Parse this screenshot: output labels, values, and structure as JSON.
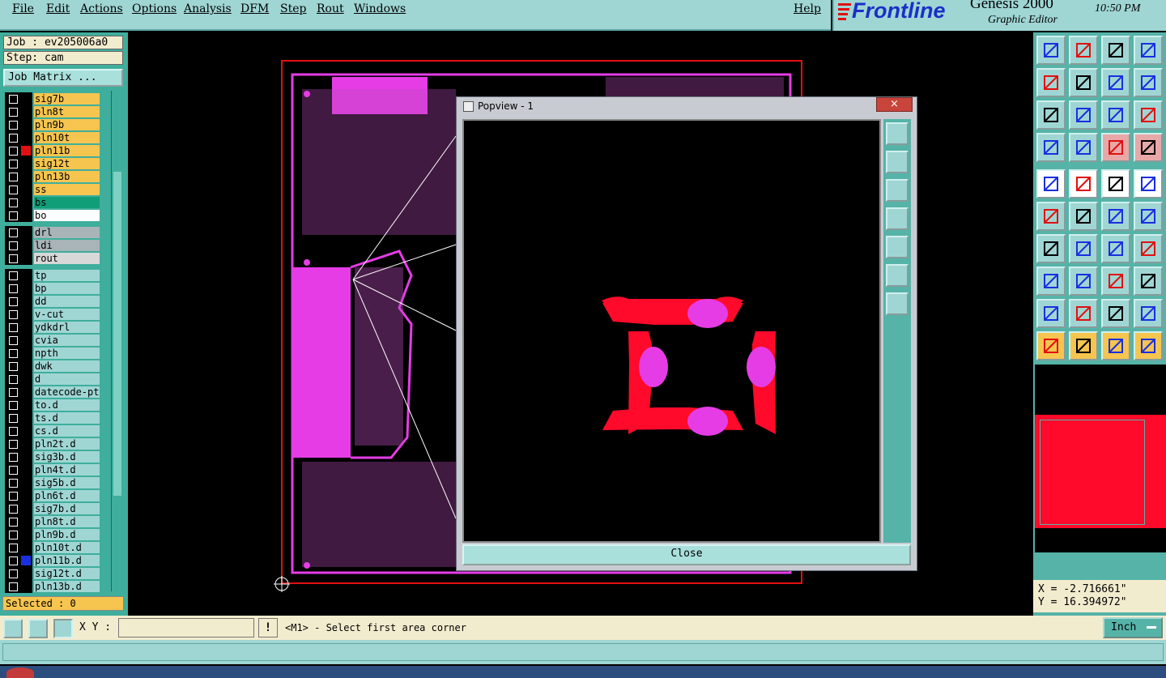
{
  "menu": {
    "items": [
      "File",
      "Edit",
      "Actions",
      "Options",
      "Analysis",
      "DFM",
      "Step",
      "Rout",
      "Windows"
    ],
    "help": "Help"
  },
  "brand": {
    "logo": "Frontline",
    "product": "Genesis 2000",
    "subtitle": "Graphic Editor",
    "time": "10:50 PM"
  },
  "job": {
    "job_label": "Job : ev205006a0",
    "step_label": "Step: cam",
    "matrix_button": "Job Matrix ..."
  },
  "layers": [
    {
      "name": "sig7b",
      "bg": "#f6c54f"
    },
    {
      "name": "pln8t",
      "bg": "#f6c54f"
    },
    {
      "name": "pln9b",
      "bg": "#f6c54f"
    },
    {
      "name": "pln10t",
      "bg": "#f6c54f"
    },
    {
      "name": "pln11b",
      "bg": "#f6c54f",
      "active": true
    },
    {
      "name": "sig12t",
      "bg": "#f6c54f"
    },
    {
      "name": "pln13b",
      "bg": "#f6c54f"
    },
    {
      "name": "ss",
      "bg": "#f6c54f"
    },
    {
      "name": "bs",
      "bg": "#109e78"
    },
    {
      "name": "bo",
      "bg": "#ffffff"
    },
    {
      "name": "drl",
      "bg": "#a8b4b8"
    },
    {
      "name": "ldi",
      "bg": "#a8b4b8"
    },
    {
      "name": "rout",
      "bg": "#d8d8d8"
    },
    {
      "name": "tp",
      "bg": "#9fd6d4"
    },
    {
      "name": "bp",
      "bg": "#9fd6d4"
    },
    {
      "name": "dd",
      "bg": "#9fd6d4"
    },
    {
      "name": "v-cut",
      "bg": "#9fd6d4"
    },
    {
      "name": "ydkdrl",
      "bg": "#9fd6d4"
    },
    {
      "name": "cvia",
      "bg": "#9fd6d4"
    },
    {
      "name": "npth",
      "bg": "#9fd6d4"
    },
    {
      "name": "dwk",
      "bg": "#9fd6d4"
    },
    {
      "name": "d",
      "bg": "#9fd6d4"
    },
    {
      "name": "datecode-pth",
      "bg": "#9fd6d4"
    },
    {
      "name": "to.d",
      "bg": "#9fd6d4"
    },
    {
      "name": "ts.d",
      "bg": "#9fd6d4"
    },
    {
      "name": "cs.d",
      "bg": "#9fd6d4"
    },
    {
      "name": "pln2t.d",
      "bg": "#9fd6d4"
    },
    {
      "name": "sig3b.d",
      "bg": "#9fd6d4"
    },
    {
      "name": "pln4t.d",
      "bg": "#9fd6d4"
    },
    {
      "name": "sig5b.d",
      "bg": "#9fd6d4"
    },
    {
      "name": "pln6t.d",
      "bg": "#9fd6d4"
    },
    {
      "name": "sig7b.d",
      "bg": "#9fd6d4"
    },
    {
      "name": "pln8t.d",
      "bg": "#9fd6d4"
    },
    {
      "name": "pln9b.d",
      "bg": "#9fd6d4"
    },
    {
      "name": "pln10t.d",
      "bg": "#9fd6d4"
    },
    {
      "name": "pln11b.d",
      "bg": "#9fd6d4",
      "marked": true
    },
    {
      "name": "sig12t.d",
      "bg": "#9fd6d4"
    },
    {
      "name": "pln13b.d",
      "bg": "#9fd6d4"
    }
  ],
  "selected": "Selected : 0",
  "popview": {
    "title": "Popview - 1",
    "close_label": "Close",
    "close_x": "×"
  },
  "coords": {
    "x": "X = -2.716661\"",
    "y": "Y = 16.394972\""
  },
  "command": {
    "xy_label": "X Y :",
    "xy_value": "",
    "prompt": "<M1> - Select first area corner",
    "warn": "!"
  },
  "units": {
    "value": "Inch"
  },
  "colors": {
    "accent": "#9fd6d4",
    "panel": "#3fae9c",
    "highlight": "#f6c54f",
    "pad_red": "#ff0a2a",
    "pad_magenta": "#e63ce6"
  }
}
